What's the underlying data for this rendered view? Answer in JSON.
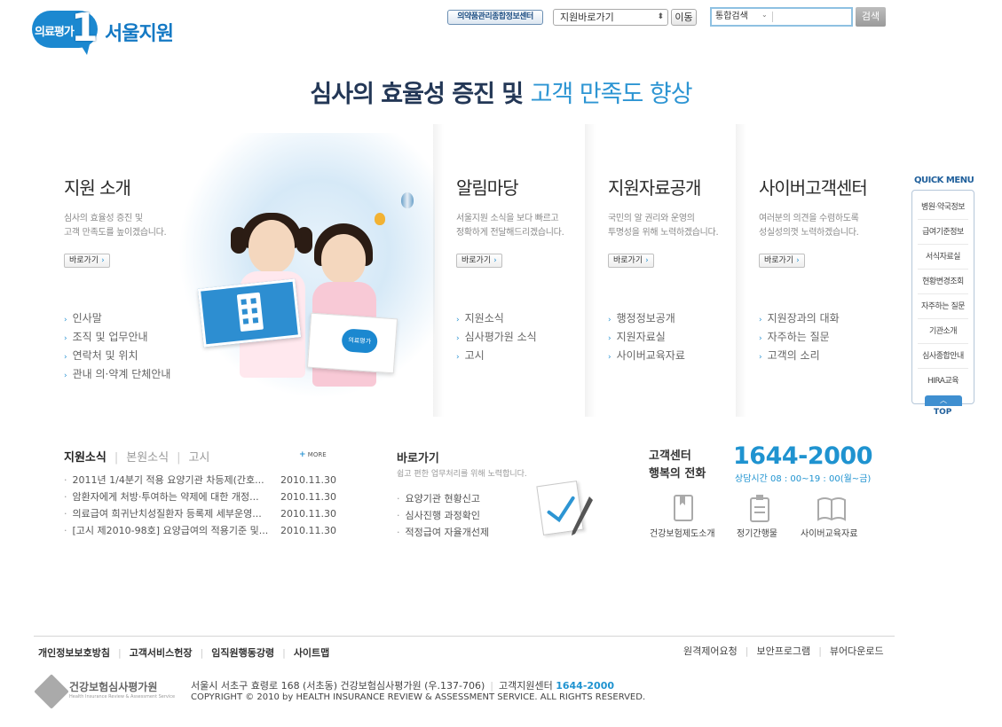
{
  "header": {
    "logo_badge": "의료평가",
    "logo_one": "1",
    "logo_name": "서울지원",
    "drug_center_label": "의약품관리종합정보센터",
    "branch_select_value": "지원바로가기",
    "go_label": "이동",
    "search_scope": "통합검색",
    "search_placeholder": "",
    "search_button": "검색"
  },
  "headline": {
    "part1": "심사의 효율성 증진 및",
    "part2": "고객 만족도 향상"
  },
  "sections": [
    {
      "title": "지원 소개",
      "desc1": "심사의 효율성 증진 및",
      "desc2": "고객 만족도를 높이겠습니다.",
      "more": "바로가기",
      "links": [
        "인사말",
        "조직 및 업무안내",
        "연락처 및 위치",
        "관내 의·약계 단체안내"
      ]
    },
    {
      "title": "알림마당",
      "desc1": "서울지원 소식을 보다 빠르고",
      "desc2": "정확하게 전달해드리겠습니다.",
      "more": "바로가기",
      "links": [
        "지원소식",
        "심사평가원 소식",
        "고시"
      ]
    },
    {
      "title": "지원자료공개",
      "desc1": "국민의 알 권리와 운영의",
      "desc2": "투명성을 위해 노력하겠습니다.",
      "more": "바로가기",
      "links": [
        "행정정보공개",
        "지원자료실",
        "사이버교육자료"
      ]
    },
    {
      "title": "사이버고객센터",
      "desc1": "여러분의 의견을 수렴하도록",
      "desc2": "성실성의껏 노력하겠습니다.",
      "more": "바로가기",
      "links": [
        "지원장과의 대화",
        "자주하는 질문",
        "고객의 소리"
      ]
    }
  ],
  "hero_card_label": "의료평가",
  "quick_menu": {
    "title": "QUICK MENU",
    "items": [
      "병원·약국정보",
      "급여기준정보",
      "서식자료실",
      "현황변경조회",
      "자주하는 질문",
      "기관소개",
      "심사종합안내",
      "HIRA교육"
    ],
    "top": "TOP"
  },
  "news": {
    "tabs": [
      "지원소식",
      "본원소식",
      "고시"
    ],
    "more": "MORE",
    "items": [
      {
        "title": "2011년 1/4분기 적용 요양기관 차등제(간호...",
        "date": "2010.11.30"
      },
      {
        "title": "암환자에게 처방·투여하는 약제에 대한 개정...",
        "date": "2010.11.30"
      },
      {
        "title": "의료급여 희귀난치성질환자 등록제 세부운영...",
        "date": "2010.11.30"
      },
      {
        "title": "[고시 제2010-98호] 요양급여의 적용기준 및...",
        "date": "2010.11.30"
      }
    ]
  },
  "shortcuts": {
    "title": "바로가기",
    "subtitle": "쉽고 편한 업무처리를 위해 노력합니다.",
    "items": [
      "요양기관 현황신고",
      "심사진행 과정확인",
      "적정급여 자율개선제"
    ]
  },
  "customer_center": {
    "title1": "고객센터",
    "title2": "행복의 전화",
    "phone": "1644-2000",
    "hours": "상담시간 08 : 00~19 : 00(월~금)",
    "icons": [
      "건강보험제도소개",
      "정기간행물",
      "사이버교육자료"
    ]
  },
  "footer": {
    "links": [
      "개인정보보호방침",
      "고객서비스헌장",
      "임직원행동강령",
      "사이트맵"
    ],
    "right_links": [
      "원격제어요청",
      "보안프로그램",
      "뷰어다운로드"
    ],
    "org_name": "건강보험심사평가원",
    "org_en": "Health Insurance Review & Assessment Service",
    "address": "서울시 서초구 효령로 168 (서초동) 건강보험심사평가원 (우.137-706)",
    "center_label": "고객지원센터",
    "center_phone": "1644-2000",
    "copyright": "COPYRIGHT © 2010 by HEALTH INSURANCE REVIEW & ASSESSMENT SERVICE. ALL RIGHTS RESERVED."
  },
  "colors": {
    "accent": "#2d95d3",
    "navy": "#233756",
    "brand": "#1b88d0"
  }
}
